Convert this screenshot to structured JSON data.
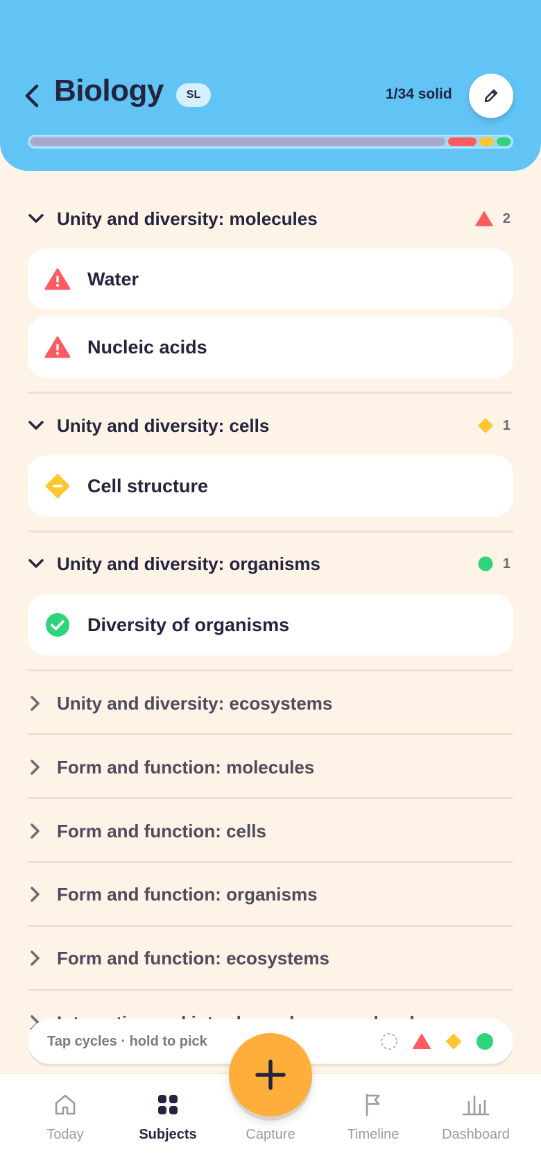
{
  "header": {
    "title": "Biology",
    "level": "SL",
    "solid_count": "1/34 solid",
    "progress": {
      "red_fraction": 0.06,
      "yellow_fraction": 0.03,
      "green_fraction": 0.03
    },
    "colors": {
      "background": "#62c3f5",
      "track": "#a8a8cc",
      "red": "#ff5a5f",
      "yellow": "#ffc632",
      "green": "#2ed47a"
    }
  },
  "sections": [
    {
      "title": "Unity and diversity: molecules",
      "expanded": true,
      "status_icon": "warning-triangle-icon",
      "count": "2",
      "topics": [
        {
          "label": "Water",
          "status": "red"
        },
        {
          "label": "Nucleic acids",
          "status": "red"
        }
      ]
    },
    {
      "title": "Unity and diversity: cells",
      "expanded": true,
      "status_icon": "diamond-icon",
      "count": "1",
      "topics": [
        {
          "label": "Cell structure",
          "status": "yellow"
        }
      ]
    },
    {
      "title": "Unity and diversity: organisms",
      "expanded": true,
      "status_icon": "circle-icon",
      "count": "1",
      "topics": [
        {
          "label": "Diversity of organisms",
          "status": "green"
        }
      ]
    },
    {
      "title": "Unity and diversity: ecosystems",
      "expanded": false
    },
    {
      "title": "Form and function: molecules",
      "expanded": false
    },
    {
      "title": "Form and function: cells",
      "expanded": false
    },
    {
      "title": "Form and function: organisms",
      "expanded": false
    },
    {
      "title": "Form and function: ecosystems",
      "expanded": false
    },
    {
      "title": "Interaction and interdependence: molecules",
      "expanded": false
    }
  ],
  "hint": {
    "text": "Tap cycles · hold to pick",
    "states": [
      "empty-circle-icon",
      "red-triangle-icon",
      "yellow-diamond-icon",
      "green-circle-icon"
    ]
  },
  "nav": {
    "items": [
      {
        "label": "Today",
        "icon": "home-icon",
        "active": false
      },
      {
        "label": "Subjects",
        "icon": "grid-icon",
        "active": true
      },
      {
        "label": "Capture",
        "icon": "plus-icon",
        "active": false
      },
      {
        "label": "Timeline",
        "icon": "flag-icon",
        "active": false
      },
      {
        "label": "Dashboard",
        "icon": "bar-chart-icon",
        "active": false
      }
    ]
  }
}
